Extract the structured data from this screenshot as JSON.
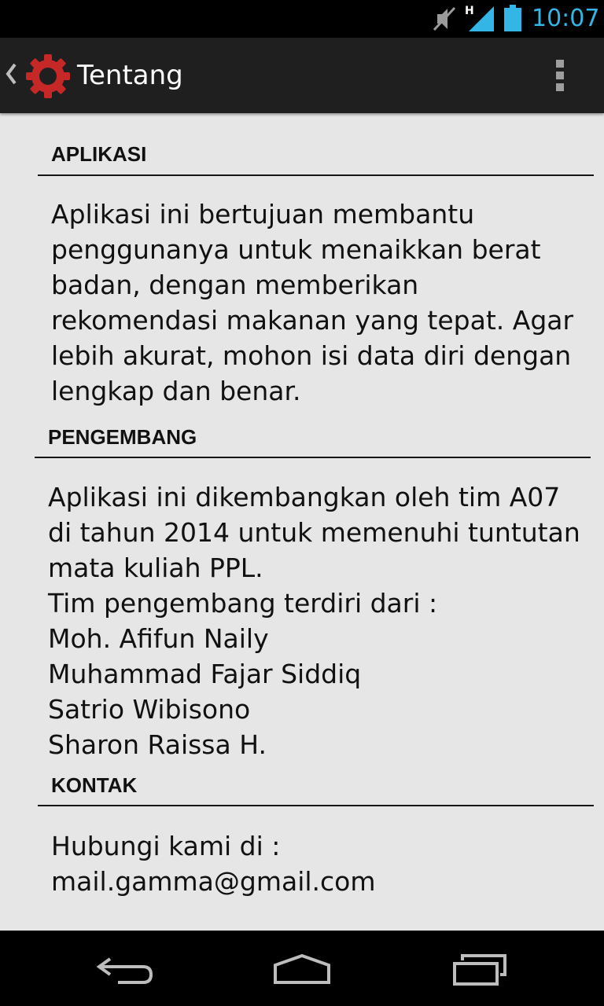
{
  "status_bar": {
    "time": "10:07",
    "network_label": "H",
    "icons": [
      "mute-icon",
      "signal-icon",
      "battery-icon"
    ],
    "accent_color": "#33b5e5"
  },
  "action_bar": {
    "title": "Tentang",
    "up_icon": "chevron-left-icon",
    "app_icon": "gear-icon",
    "app_icon_color": "#d32f2f",
    "overflow_icon": "overflow-menu-icon"
  },
  "sections": {
    "aplikasi": {
      "header": "APLIKASI",
      "lines": [
        "Aplikasi ini bertujuan membantu",
        "penggunanya untuk menaikkan berat",
        "badan, dengan memberikan",
        "rekomendasi makanan yang tepat. Agar",
        "lebih akurat, mohon isi data diri dengan",
        "lengkap dan benar."
      ]
    },
    "pengembang": {
      "header": "PENGEMBANG",
      "lines": [
        "Aplikasi ini dikembangkan oleh tim A07",
        "di tahun 2014 untuk memenuhi tuntutan",
        "mata kuliah PPL.",
        "Tim pengembang terdiri dari :",
        "Moh. Afifun Naily",
        "Muhammad Fajar Siddiq",
        "Satrio Wibisono",
        "Sharon Raissa H."
      ]
    },
    "kontak": {
      "header": "KONTAK",
      "lines": [
        "Hubungi kami di :",
        "mail.gamma@gmail.com"
      ]
    }
  },
  "nav_bar": {
    "icons": [
      "back-icon",
      "home-icon",
      "recent-apps-icon"
    ]
  }
}
